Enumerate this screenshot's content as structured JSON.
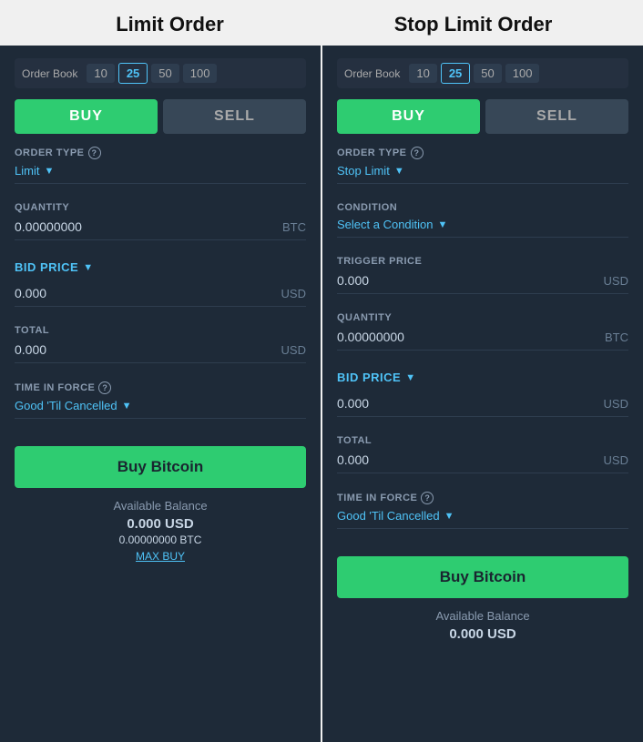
{
  "left_panel": {
    "title": "Limit Order",
    "order_book": {
      "label": "Order Book",
      "options": [
        "10",
        "25",
        "50",
        "100"
      ],
      "active": "25"
    },
    "buy_label": "BUY",
    "sell_label": "SELL",
    "order_type_label": "ORDER TYPE",
    "order_type_value": "Limit",
    "quantity_label": "QUANTITY",
    "quantity_value": "0.00000000",
    "quantity_unit": "BTC",
    "bid_price_label": "BID PRICE",
    "bid_price_value": "0.000",
    "bid_price_unit": "USD",
    "total_label": "TOTAL",
    "total_value": "0.000",
    "total_unit": "USD",
    "time_in_force_label": "TIME IN FORCE",
    "time_in_force_value": "Good 'Til Cancelled",
    "action_button": "Buy Bitcoin",
    "available_balance_label": "Available Balance",
    "available_usd": "0.000  USD",
    "available_btc": "0.00000000  BTC",
    "max_buy": "MAX BUY"
  },
  "right_panel": {
    "title": "Stop Limit Order",
    "order_book": {
      "label": "Order Book",
      "options": [
        "10",
        "25",
        "50",
        "100"
      ],
      "active": "25"
    },
    "buy_label": "BUY",
    "sell_label": "SELL",
    "order_type_label": "ORDER TYPE",
    "order_type_value": "Stop Limit",
    "condition_label": "CONDITION",
    "condition_value": "Select a Condition",
    "trigger_price_label": "TRIGGER PRICE",
    "trigger_price_value": "0.000",
    "trigger_price_unit": "USD",
    "quantity_label": "QUANTITY",
    "quantity_value": "0.00000000",
    "quantity_unit": "BTC",
    "bid_price_label": "BID PRICE",
    "bid_price_value": "0.000",
    "bid_price_unit": "USD",
    "total_label": "TOTAL",
    "total_value": "0.000",
    "total_unit": "USD",
    "time_in_force_label": "TIME IN FORCE",
    "time_in_force_value": "Good 'Til Cancelled",
    "action_button": "Buy Bitcoin",
    "available_balance_label": "Available Balance",
    "available_usd": "0.000  USD"
  },
  "info_icon_text": "?",
  "arrow_down": "▼"
}
